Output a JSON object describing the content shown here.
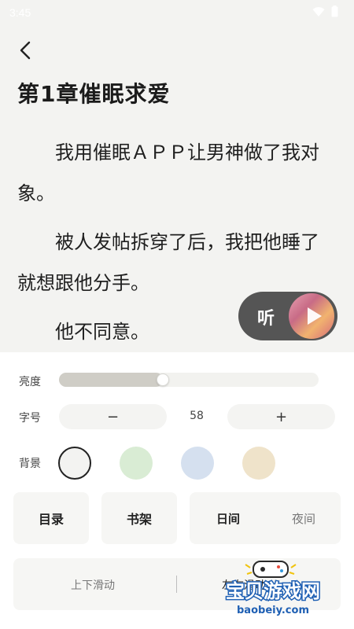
{
  "status_bar": {
    "time": "3:45"
  },
  "reader": {
    "chapter_title": "第1章催眠求爱",
    "paragraphs": [
      "我用催眠ＡＰＰ让男神做了我对象。",
      "被人发帖拆穿了后，我把他睡了就想跟他分手。",
      "他不同意。"
    ]
  },
  "listen": {
    "label": "听"
  },
  "settings": {
    "brightness_label": "亮度",
    "brightness_level": 0.4,
    "font_size_label": "字号",
    "font_decrease": "−",
    "font_size_value": "58",
    "font_increase": "+",
    "background_label": "背景",
    "background_colors": [
      "#f3f3f1",
      "#d9ecd4",
      "#d5e0ef",
      "#efe3ca"
    ],
    "catalog": "目录",
    "bookshelf": "书架",
    "day_mode": "日间",
    "night_mode": "夜间",
    "scroll_vertical": "上下滑动",
    "scroll_horizontal": "左右滑动"
  },
  "watermark": {
    "name": "宝贝游戏网",
    "url": "baobeiy.com"
  }
}
